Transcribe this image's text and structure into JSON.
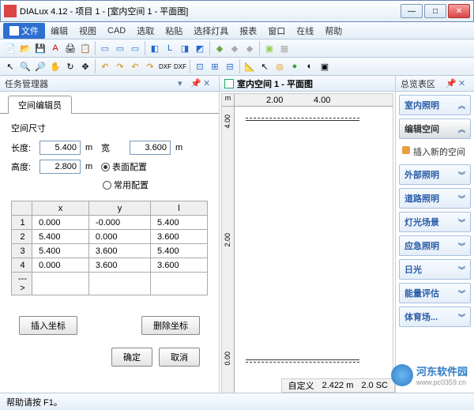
{
  "window": {
    "title": "DIALux 4.12 - 项目 1 - [室内空间 1 - 平面图]"
  },
  "menu": {
    "file": "文件",
    "items": [
      "编辑",
      "视图",
      "CAD",
      "选取",
      "粘贴",
      "选择灯具",
      "报表",
      "窗口",
      "在线",
      "帮助"
    ]
  },
  "taskmgr": {
    "title": "任务管理器",
    "tab": "空间编辑员",
    "sizetitle": "空间尺寸",
    "length_lbl": "长度:",
    "length_val": "5.400",
    "width_lbl": "宽",
    "width_val": "3.600",
    "height_lbl": "高度:",
    "height_val": "2.800",
    "unit": "m",
    "radio1": "表面配置",
    "radio2": "常用配置",
    "table": {
      "headers": [
        "",
        "x",
        "y",
        "l"
      ],
      "rows": [
        [
          "1",
          "0.000",
          "-0.000",
          "5.400"
        ],
        [
          "2",
          "5.400",
          "0.000",
          "3.600"
        ],
        [
          "3",
          "5.400",
          "3.600",
          "5.400"
        ],
        [
          "4",
          "0.000",
          "3.600",
          "3.600"
        ]
      ],
      "arrow": "--->"
    },
    "insert_btn": "插入坐标",
    "delete_btn": "删除坐标",
    "ok_btn": "确定",
    "cancel_btn": "取消"
  },
  "canvas": {
    "title": "室内空间 1 - 平面图",
    "ruler_m": "m",
    "rticks_h": [
      "2.00",
      "4.00"
    ],
    "rticks_v": [
      "4.00",
      "2.00",
      "0.00"
    ]
  },
  "overview": {
    "title": "总览表区",
    "items": [
      "室内照明",
      "外部照明",
      "道路照明",
      "灯光场景",
      "应急照明",
      "日光",
      "能量评估",
      "体育场..."
    ],
    "edit": "编辑空间",
    "sub": "插入新的空间"
  },
  "status": {
    "help": "帮助请按 F1。",
    "coord": "2.422 m",
    "scale": "2.0  SC",
    "custom": "自定义"
  },
  "wm": {
    "text": "河东软件园",
    "url": "www.pc0359.cn"
  }
}
